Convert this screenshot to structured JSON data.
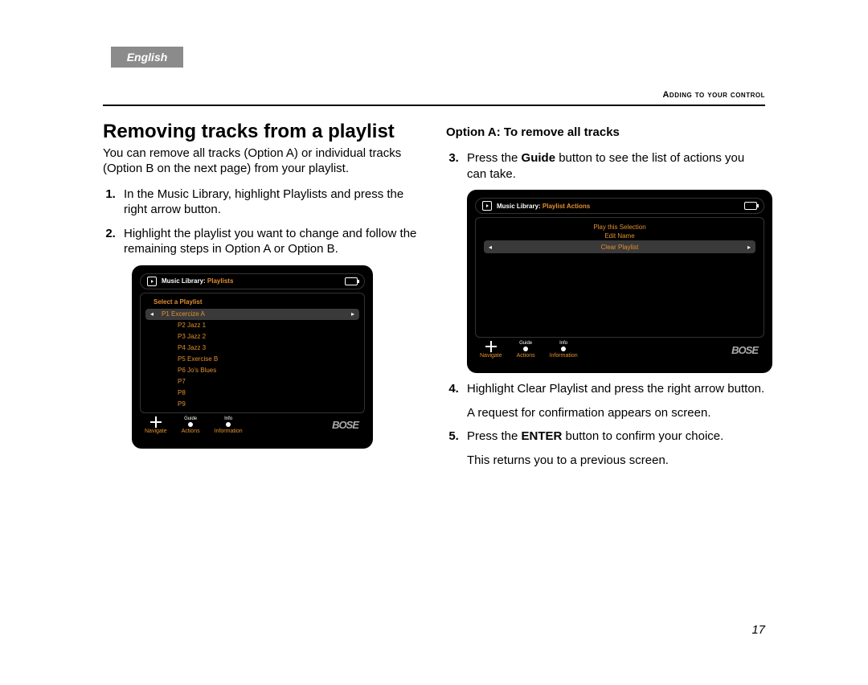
{
  "language_tab": "English",
  "section_header": "Adding to your control",
  "page_number": "17",
  "left": {
    "title": "Removing tracks from a playlist",
    "intro": "You can remove all tracks (Option A) or individual tracks (Option B on the next page) from your playlist.",
    "step1": "In the Music Library, highlight Playlists and press the right arrow button.",
    "step2": "Highlight the playlist you want to change and follow the remaining steps in Option A or Option B."
  },
  "right": {
    "option_title": "Option A: To remove all tracks",
    "step3_a": "Press the ",
    "step3_bold": "Guide",
    "step3_b": " button to see the list of actions you can take.",
    "step4": "Highlight Clear Playlist and press the right arrow button.",
    "step4_note": "A request for confirmation appears on screen.",
    "step5_a": "Press the ",
    "step5_bold": "ENTER",
    "step5_b": " button to confirm your choice.",
    "step5_note": "This returns you to a previous screen."
  },
  "tv1": {
    "crumb1": "Music Library:",
    "crumb2": "Playlists",
    "list_title": "Select a Playlist",
    "selected": "P1 Excercize A",
    "items": {
      "i1": "P2 Jazz 1",
      "i2": "P3 Jazz 2",
      "i3": "P4 Jazz 3",
      "i4": "P5 Exercise B",
      "i5": "P6 Jo's Blues",
      "i6": "P7",
      "i7": "P8",
      "i8": "P9"
    },
    "foot": {
      "nav": "Navigate",
      "guide_top": "Guide",
      "guide_bot": "Actions",
      "info_top": "Info",
      "info_bot": "Information"
    },
    "brand": "BOSE"
  },
  "tv2": {
    "crumb1": "Music Library:",
    "crumb2": "Playlist Actions",
    "act1": "Play this Selection",
    "act2": "Edit Name",
    "act3": "Clear Playlist",
    "foot": {
      "nav": "Navigate",
      "guide_top": "Guide",
      "guide_bot": "Actions",
      "info_top": "Info",
      "info_bot": "Information"
    },
    "brand": "BOSE"
  }
}
